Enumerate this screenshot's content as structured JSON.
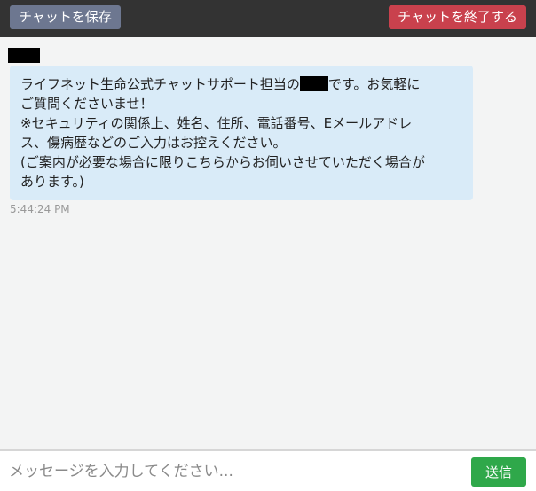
{
  "header": {
    "save_label": "チャットを保存",
    "end_label": "チャットを終了する"
  },
  "message": {
    "line1_before": "ライフネット生命公式チャットサポート担当の",
    "line1_after": "です。お気軽に",
    "line2": "ご質問くださいませ！",
    "line3": "※セキュリティの関係上、姓名、住所、電話番号、Eメールアドレ",
    "line4": "ス、傷病歴などのご入力はお控えください。",
    "line5": "(ご案内が必要な場合に限りこちらからお伺いさせていただく場合が",
    "line6": "あります。)",
    "timestamp": "5:44:24 PM"
  },
  "composer": {
    "placeholder": "メッセージを入力してください...",
    "send_label": "送信"
  },
  "colors": {
    "topbar": "#333333",
    "save_button": "#6d7790",
    "end_button": "#c9414d",
    "bubble": "#d9ebf8",
    "send_button": "#2fa84a"
  }
}
